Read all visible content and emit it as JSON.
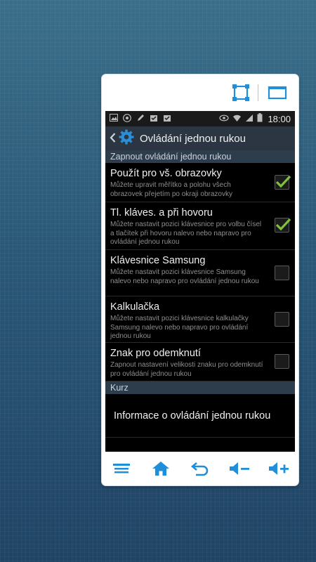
{
  "statusbar": {
    "time": "18:00"
  },
  "actionbar": {
    "title": "Ovládání jednou rukou"
  },
  "sections": {
    "enable_header": "Zapnout ovládání jednou rukou",
    "course_header": "Kurz"
  },
  "settings": [
    {
      "title": "Použít pro vš. obrazovky",
      "description": "Můžete upravit měřítko a polohu všech obrazovek přejetím po okraji obrazovky",
      "checked": true
    },
    {
      "title": "Tl. kláves. a při hovoru",
      "description": "Můžete nastavit pozici klávesnice pro volbu čísel a tlačítek při hovoru nalevo nebo napravo pro ovládání jednou rukou",
      "checked": true
    },
    {
      "title": "Klávesnice Samsung",
      "description": "Můžete nastavit pozici klávesnice Samsung nalevo nebo napravo pro ovládání jednou rukou",
      "checked": false
    },
    {
      "title": "Kalkulačka",
      "description": "Můžete nastavit pozici klávesnice kalkulačky Samsung nalevo nebo napravo pro ovládání jednou rukou",
      "checked": false
    },
    {
      "title": "Znak pro odemknutí",
      "description": "Zapnout nastavení velikosti znaku pro odemknutí pro ovládání jednou rukou",
      "checked": false
    }
  ],
  "info": {
    "label": "Informace o ovládání jednou rukou"
  },
  "icons": {
    "frame_top": [
      "resize-icon",
      "window-icon"
    ],
    "bottom": [
      "menu-icon",
      "home-icon",
      "back-icon",
      "volume-down-icon",
      "volume-up-icon"
    ]
  },
  "colors": {
    "accent": "#2a8fd6",
    "check": "#7fc23a",
    "header_bg": "#2e3d4c"
  }
}
